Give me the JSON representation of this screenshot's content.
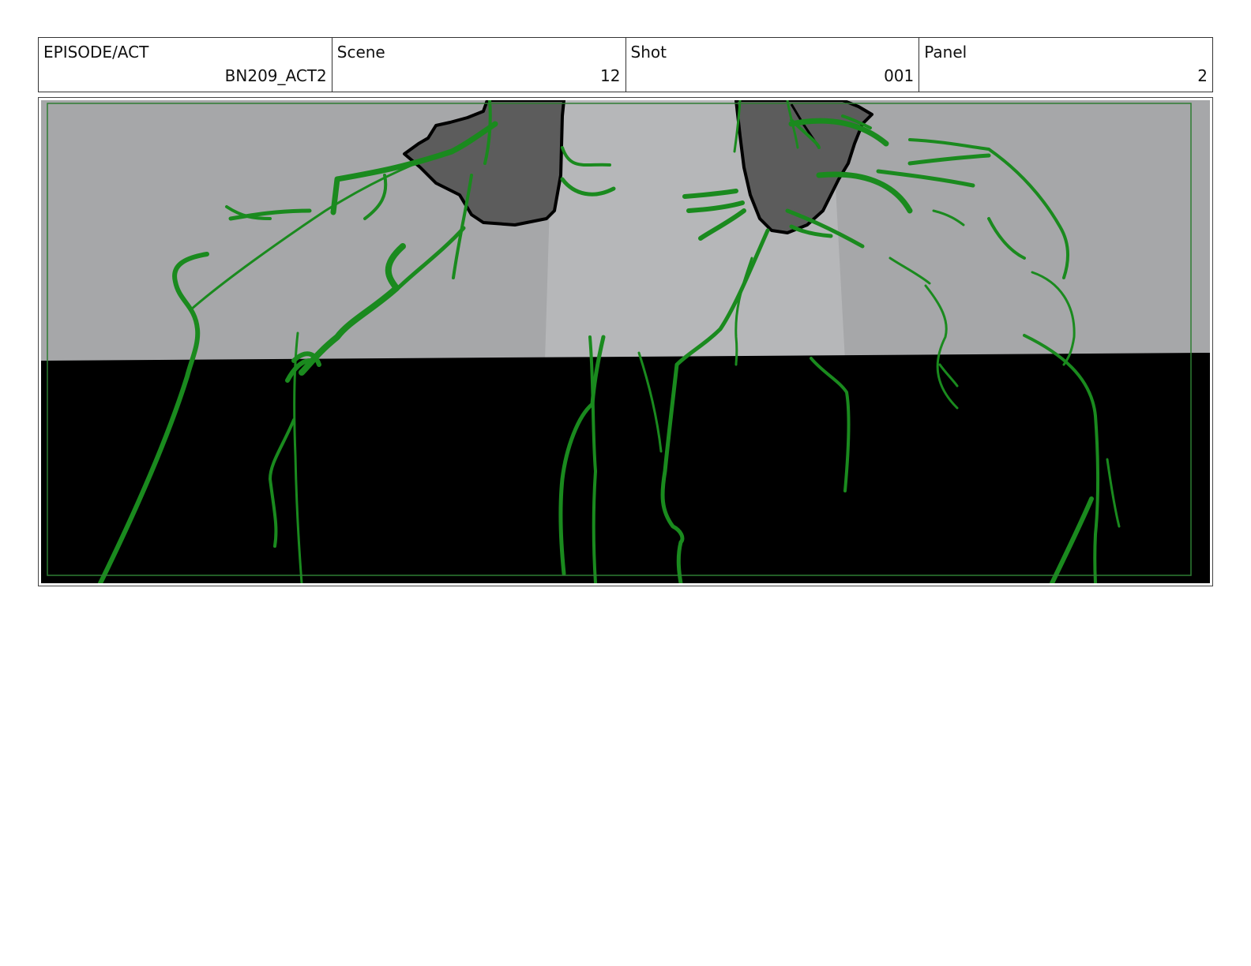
{
  "header": {
    "episode": {
      "label": "EPISODE/ACT",
      "value": "BN209_ACT2"
    },
    "scene": {
      "label": "Scene",
      "value": "12"
    },
    "shot": {
      "label": "Shot",
      "value": "001"
    },
    "panel": {
      "label": "Panel",
      "value": "2"
    }
  },
  "artwork": {
    "colors": {
      "wall": "#a6a7a9",
      "wall_light": "#b6b7b9",
      "floor": "#000000",
      "rock": "#5c5c5c",
      "sketch_line": "#1a8a1e",
      "safe_frame": "#2e7d32"
    }
  }
}
